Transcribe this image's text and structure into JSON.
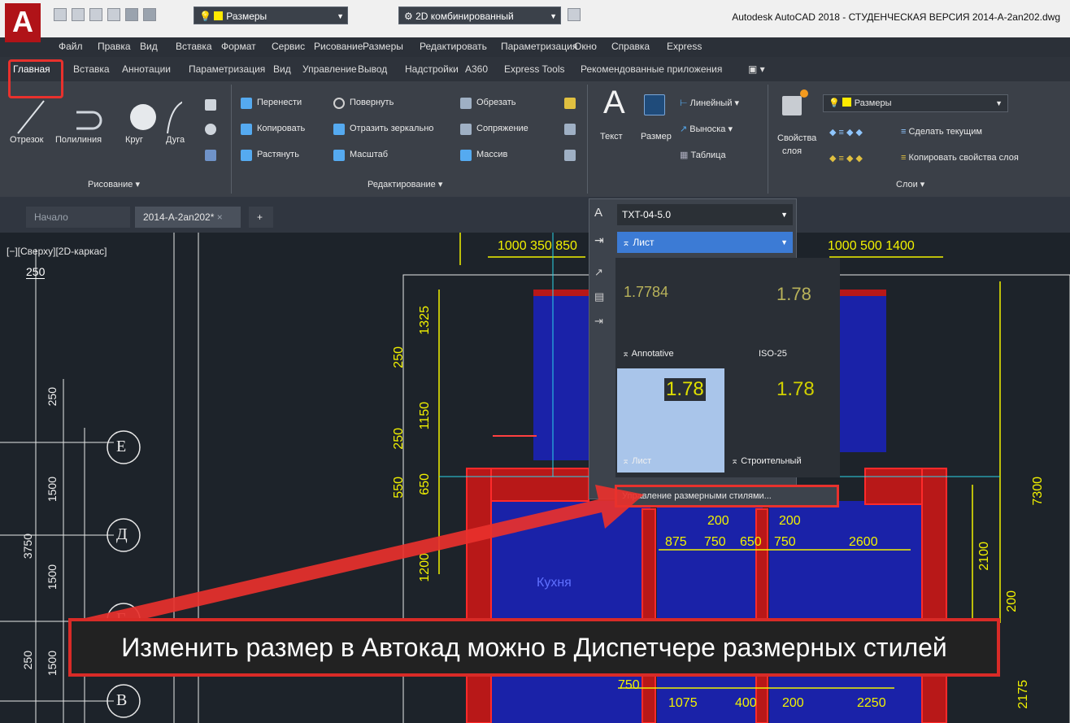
{
  "app": {
    "title": "Autodesk AutoCAD 2018 - СТУДЕНЧЕСКАЯ ВЕРСИЯ    2014-A-2an202.dwg",
    "logo": "A"
  },
  "quick_access": {
    "layer": "Размеры",
    "workspace": "2D комбинированный"
  },
  "menu": [
    "Файл",
    "Правка",
    "Вид",
    "Вставка",
    "Формат",
    "Сервис",
    "Рисование",
    "Размеры",
    "Редактировать",
    "Параметризация",
    "Окно",
    "Справка",
    "Express"
  ],
  "ribbon_tabs": [
    "Главная",
    "Вставка",
    "Аннотации",
    "Параметризация",
    "Вид",
    "Управление",
    "Вывод",
    "Надстройки",
    "A360",
    "Express Tools",
    "Рекомендованные приложения"
  ],
  "draw_panel": {
    "tools": [
      "Отрезок",
      "Полилиния",
      "Круг",
      "Дуга"
    ],
    "title": "Рисование ▾"
  },
  "modify_panel": {
    "col1": [
      "Перенести",
      "Копировать",
      "Растянуть"
    ],
    "col2": [
      "Повернуть",
      "Отразить зеркально",
      "Масштаб"
    ],
    "col3": [
      "Обрезать",
      "Сопряжение",
      "Массив"
    ],
    "title": "Редактирование ▾"
  },
  "annotation_panel": {
    "text": "Текст",
    "dimension": "Размер",
    "linear": "Линейный",
    "leader": "Выноска",
    "table": "Таблица"
  },
  "layers_panel": {
    "properties_line1": "Свойства",
    "properties_line2": "слоя",
    "layer": "Размеры",
    "make_current": "Сделать текущим",
    "match": "Копировать свойства слоя",
    "title": "Слои ▾"
  },
  "doc_tabs": [
    "Начало",
    "2014-A-2an202*"
  ],
  "viewport_label": "[−][Сверху][2D-каркас]",
  "dropdown": {
    "text_style": "TXT-04-5.0",
    "dim_style": "Лист",
    "styles": [
      {
        "name": "Annotative",
        "preview": "1.7784"
      },
      {
        "name": "ISO-25",
        "preview": "1.78"
      },
      {
        "name": "Лист",
        "preview": "1.78"
      },
      {
        "name": "Строительный",
        "preview": "1.78"
      }
    ],
    "manage": "Управление размерными стилями..."
  },
  "drawing": {
    "axes": [
      "Е",
      "Д",
      "Г",
      "В"
    ],
    "dims_top_left": [
      "1000",
      "350",
      "850"
    ],
    "dims_top_right": [
      "1000",
      "500",
      "1400"
    ],
    "dims_left": [
      "250",
      "1500",
      "3750",
      "1500",
      "1500",
      "250"
    ],
    "dims_vertical": [
      "1325",
      "250",
      "1150",
      "250",
      "650",
      "550",
      "1200"
    ],
    "dims_middle": [
      "875",
      "750",
      "650",
      "750",
      "200",
      "200",
      "2600"
    ],
    "dims_right": [
      "7300",
      "2100",
      "200",
      "2175"
    ],
    "dims_bottom": [
      "750",
      "1075",
      "400",
      "200",
      "2250"
    ],
    "room_label": "Кухня",
    "scale_label": "250"
  },
  "callout": "Изменить размер в Автокад можно в Диспетчере размерных стилей"
}
